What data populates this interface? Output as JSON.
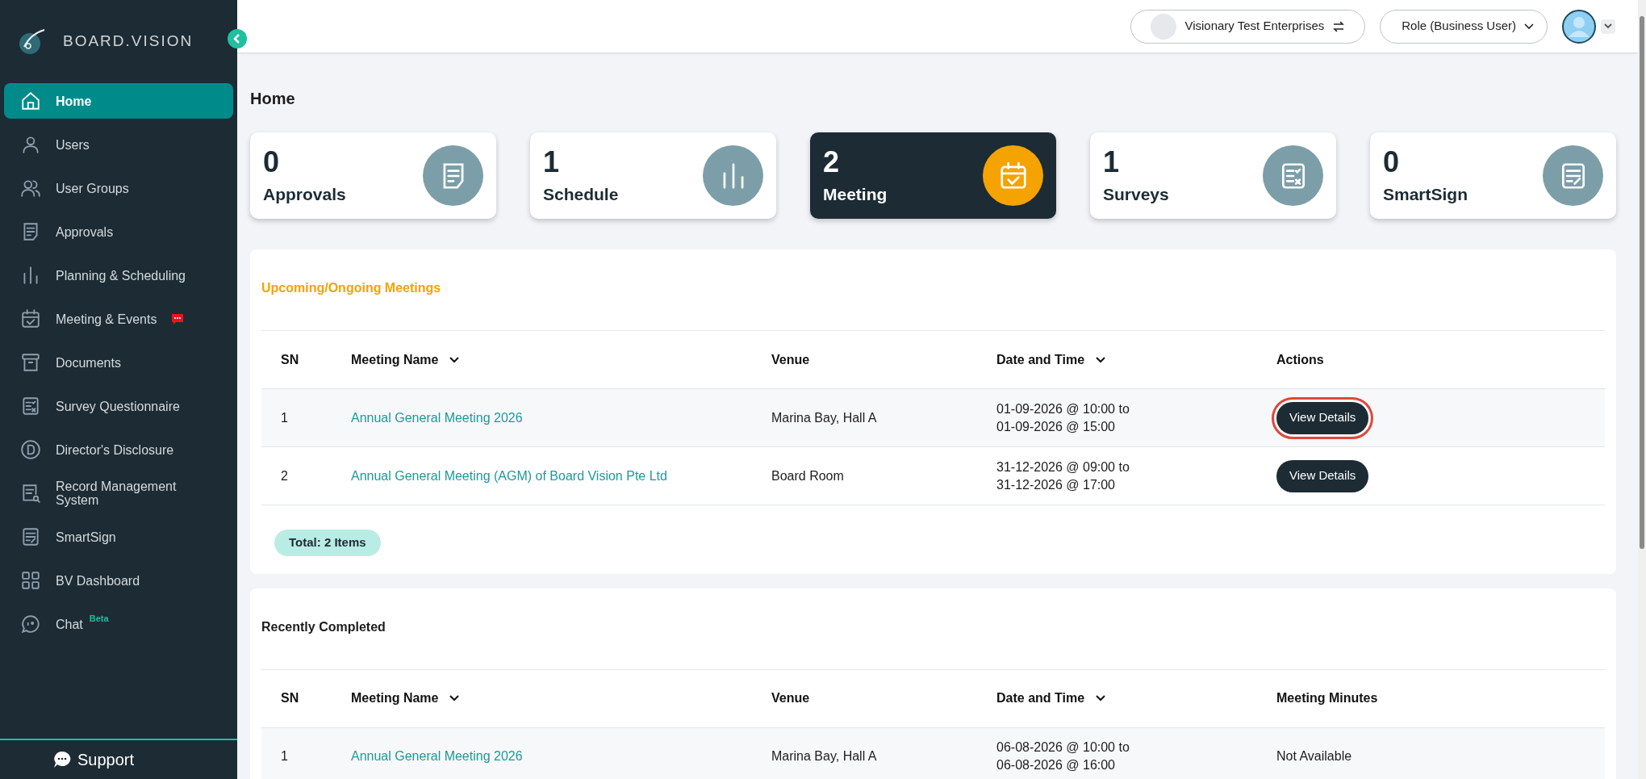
{
  "brand": {
    "name": "BOARD.VISION"
  },
  "sidebar": {
    "items": [
      {
        "label": "Home",
        "kind": "home",
        "selected": true,
        "notification": false
      },
      {
        "label": "Users",
        "kind": "user",
        "selected": false,
        "notification": false
      },
      {
        "label": "User Groups",
        "kind": "users",
        "selected": false,
        "notification": false
      },
      {
        "label": "Approvals",
        "kind": "doc",
        "selected": false,
        "notification": false
      },
      {
        "label": "Planning & Scheduling",
        "kind": "bars",
        "selected": false,
        "notification": false
      },
      {
        "label": "Meeting & Events",
        "kind": "calendar",
        "selected": false,
        "notification": true
      },
      {
        "label": "Documents",
        "kind": "archive",
        "selected": false,
        "notification": false
      },
      {
        "label": "Survey Questionnaire",
        "kind": "survey",
        "selected": false,
        "notification": false
      },
      {
        "label": "Director's Disclosure",
        "kind": "disclosure",
        "selected": false,
        "notification": false
      },
      {
        "label": "Record Management System",
        "kind": "record",
        "selected": false,
        "notification": false
      },
      {
        "label": "SmartSign",
        "kind": "sign",
        "selected": false,
        "notification": false
      },
      {
        "label": "BV Dashboard",
        "kind": "grid",
        "selected": false,
        "notification": false
      },
      {
        "label": "Chat",
        "kind": "chat",
        "selected": false,
        "notification": false,
        "tag": "Beta"
      }
    ],
    "support": "Support"
  },
  "header": {
    "organization": "Visionary Test Enterprises",
    "role": "Role (Business User)"
  },
  "page_title": "Home",
  "cards": [
    {
      "count": "0",
      "label": "Approvals",
      "kind": "doc",
      "selected": false
    },
    {
      "count": "1",
      "label": "Schedule",
      "kind": "bars",
      "selected": false
    },
    {
      "count": "2",
      "label": "Meeting",
      "kind": "calendar",
      "selected": true
    },
    {
      "count": "1",
      "label": "Surveys",
      "kind": "survey",
      "selected": false
    },
    {
      "count": "0",
      "label": "SmartSign",
      "kind": "sign",
      "selected": false
    }
  ],
  "sections": [
    {
      "title": "Upcoming/Ongoing Meetings",
      "accent": true,
      "columns": [
        {
          "label": "SN",
          "sortable": false
        },
        {
          "label": "Meeting Name",
          "sortable": true
        },
        {
          "label": "Venue",
          "sortable": false
        },
        {
          "label": "Date and Time",
          "sortable": true
        },
        {
          "label": "Actions",
          "sortable": false
        }
      ],
      "rows": [
        {
          "sn": "1",
          "name": "Annual General Meeting 2026",
          "venue": "Marina Bay, Hall A",
          "date_time": "01-09-2026 @ 10:00 to 01-09-2026 @ 15:00",
          "last": {
            "kind": "button",
            "text": "View Details",
            "highlighted": true
          }
        },
        {
          "sn": "2",
          "name": "Annual General Meeting (AGM) of Board Vision Pte Ltd",
          "venue": "Board Room",
          "date_time": "31-12-2026 @ 09:00 to 31-12-2026 @ 17:00",
          "last": {
            "kind": "button",
            "text": "View Details",
            "highlighted": false
          }
        }
      ],
      "total": "Total: 2 Items"
    },
    {
      "title": "Recently Completed",
      "accent": false,
      "columns": [
        {
          "label": "SN",
          "sortable": false
        },
        {
          "label": "Meeting Name",
          "sortable": true
        },
        {
          "label": "Venue",
          "sortable": false
        },
        {
          "label": "Date and Time",
          "sortable": true
        },
        {
          "label": "Meeting Minutes",
          "sortable": false
        }
      ],
      "rows": [
        {
          "sn": "1",
          "name": "Annual General Meeting 2026",
          "venue": "Marina Bay, Hall A",
          "date_time": "06-08-2026 @ 10:00 to 06-08-2026 @ 16:00",
          "last": {
            "kind": "text",
            "text": "Not Available"
          }
        }
      ]
    }
  ]
}
